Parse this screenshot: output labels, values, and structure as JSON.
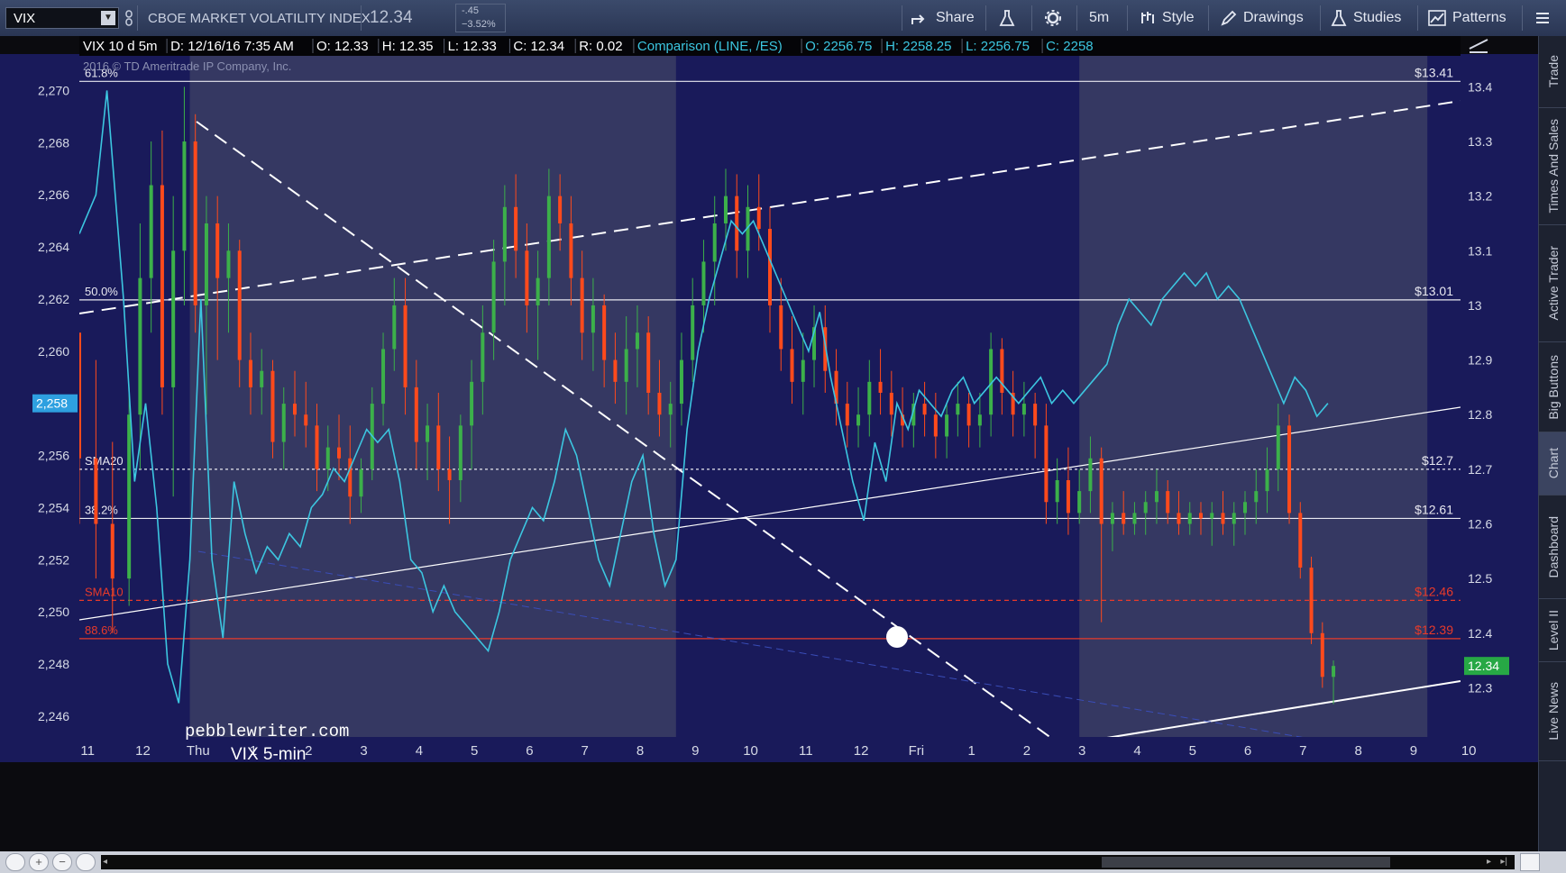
{
  "toolbar": {
    "symbol": "VIX",
    "title": "CBOE MARKET VOLATILITY INDEX",
    "last": "12.34",
    "change": "-.45",
    "change_pct": "−3.52%",
    "buttons": [
      {
        "label": "Share",
        "icon": "share-icon"
      },
      {
        "label": "",
        "icon": "flask-icon"
      },
      {
        "label": "",
        "icon": "gear-icon"
      },
      {
        "label": "5m",
        "icon": ""
      },
      {
        "label": "Style",
        "icon": "style-icon"
      },
      {
        "label": "Drawings",
        "icon": "pencil-icon"
      },
      {
        "label": "Studies",
        "icon": "flask-icon"
      },
      {
        "label": "Patterns",
        "icon": "patterns-icon"
      },
      {
        "label": "",
        "icon": "menu-icon"
      }
    ]
  },
  "header": {
    "study": "VIX 10 d 5m",
    "date": "D: 12/16/16 7:35 AM",
    "open": "O: 12.33",
    "high": "H: 12.35",
    "low": "L: 12.33",
    "close": "C: 12.34",
    "range": "R: 0.02",
    "comparison": "Comparison (LINE, /ES)",
    "cmp_open": "O: 2256.75",
    "cmp_high": "H: 2258.25",
    "cmp_low": "L: 2256.75",
    "cmp_close": "C: 2258"
  },
  "copyright": "2016 © TD Ameritrade IP Company, Inc.",
  "watermark": {
    "line1": "pebblewriter.com",
    "line2": "VIX 5-min"
  },
  "right_tabs": [
    "Trade",
    "Times And Sales",
    "Active Trader",
    "Big Buttons",
    "Chart",
    "Dashboard",
    "Level II",
    "Live News"
  ],
  "colors": {
    "background": "#191a5a",
    "shade": "#353862",
    "candle_up": "#3cb04a",
    "candle_down": "#ff4a1c",
    "compare_line": "#3cc6e0",
    "level_red": "#e83a2a"
  },
  "chart_data": {
    "type": "candlestick_with_comparison_line",
    "left_axis": {
      "label": "/ES",
      "ticks": [
        "2,270",
        "2,268",
        "2,266",
        "2,264",
        "2,262",
        "2,260",
        "2,258",
        "2,256",
        "2,254",
        "2,252",
        "2,250",
        "2,248",
        "2,246"
      ],
      "range": [
        2245.2,
        2271.4
      ]
    },
    "right_axis": {
      "label": "VIX",
      "ticks": [
        "13.4",
        "13.3",
        "13.2",
        "13.1",
        "13",
        "12.9",
        "12.8",
        "12.7",
        "12.6",
        "12.5",
        "12.4",
        "12.3"
      ],
      "range": [
        12.21,
        13.46
      ]
    },
    "left_marker": "2,258",
    "right_marker": "12.34",
    "x_ticks": [
      "11",
      "12",
      "Thu",
      "1",
      "2",
      "3",
      "4",
      "5",
      "6",
      "7",
      "8",
      "9",
      "10",
      "11",
      "12",
      "Fri",
      "1",
      "2",
      "3",
      "4",
      "5",
      "6",
      "7",
      "8",
      "9",
      "10"
    ],
    "session_shading": [
      {
        "from": 2.0,
        "to": 10.8
      },
      {
        "from": 18.1,
        "to": 24.4
      }
    ],
    "levels": [
      {
        "price": 13.41,
        "label": "$13.41",
        "fib": "61.8%",
        "style": "solid",
        "color": "white"
      },
      {
        "price": 13.01,
        "label": "$13.01",
        "fib": "50.0%",
        "style": "solid",
        "color": "white"
      },
      {
        "price": 12.7,
        "label": "$12.7",
        "fib": "SMA20",
        "style": "dotted",
        "color": "white"
      },
      {
        "price": 12.61,
        "label": "$12.61",
        "fib": "38.2%",
        "style": "solid",
        "color": "white"
      },
      {
        "price": 12.46,
        "label": "$12.46",
        "fib": "SMA10",
        "style": "dashed",
        "color": "red"
      },
      {
        "price": 12.39,
        "label": "$12.39",
        "fib": "88.6%",
        "style": "solid",
        "color": "red"
      }
    ],
    "vix_candles": [
      [
        0.0,
        12.95,
        12.95,
        12.6,
        12.72
      ],
      [
        0.3,
        12.72,
        12.9,
        12.5,
        12.6
      ],
      [
        0.6,
        12.6,
        12.75,
        12.4,
        12.5
      ],
      [
        0.9,
        12.5,
        12.85,
        12.45,
        12.8
      ],
      [
        1.1,
        12.8,
        13.15,
        12.7,
        13.05
      ],
      [
        1.3,
        13.05,
        13.3,
        12.95,
        13.22
      ],
      [
        1.5,
        13.22,
        13.32,
        12.8,
        12.85
      ],
      [
        1.7,
        12.85,
        13.2,
        12.65,
        13.1
      ],
      [
        1.9,
        13.1,
        13.4,
        13.0,
        13.3
      ],
      [
        2.1,
        13.3,
        13.35,
        12.95,
        13.0
      ],
      [
        2.3,
        13.0,
        13.2,
        12.8,
        13.15
      ],
      [
        2.5,
        13.15,
        13.2,
        12.9,
        13.05
      ],
      [
        2.7,
        13.05,
        13.15,
        12.95,
        13.1
      ],
      [
        2.9,
        13.1,
        13.12,
        12.85,
        12.9
      ],
      [
        3.1,
        12.9,
        12.95,
        12.8,
        12.85
      ],
      [
        3.3,
        12.85,
        12.92,
        12.8,
        12.88
      ],
      [
        3.5,
        12.88,
        12.9,
        12.72,
        12.75
      ],
      [
        3.7,
        12.75,
        12.85,
        12.7,
        12.82
      ],
      [
        3.9,
        12.82,
        12.88,
        12.76,
        12.8
      ],
      [
        4.1,
        12.8,
        12.86,
        12.74,
        12.78
      ],
      [
        4.3,
        12.78,
        12.82,
        12.66,
        12.7
      ],
      [
        4.5,
        12.7,
        12.78,
        12.66,
        12.74
      ],
      [
        4.7,
        12.74,
        12.8,
        12.68,
        12.72
      ],
      [
        4.9,
        12.72,
        12.78,
        12.6,
        12.65
      ],
      [
        5.1,
        12.65,
        12.72,
        12.62,
        12.7
      ],
      [
        5.3,
        12.7,
        12.85,
        12.68,
        12.82
      ],
      [
        5.5,
        12.82,
        12.95,
        12.78,
        12.92
      ],
      [
        5.7,
        12.92,
        13.05,
        12.88,
        13.0
      ],
      [
        5.9,
        13.0,
        13.05,
        12.8,
        12.85
      ],
      [
        6.1,
        12.85,
        12.9,
        12.7,
        12.75
      ],
      [
        6.3,
        12.75,
        12.82,
        12.68,
        12.78
      ],
      [
        6.5,
        12.78,
        12.84,
        12.66,
        12.7
      ],
      [
        6.7,
        12.7,
        12.76,
        12.6,
        12.68
      ],
      [
        6.9,
        12.68,
        12.8,
        12.64,
        12.78
      ],
      [
        7.1,
        12.78,
        12.9,
        12.7,
        12.86
      ],
      [
        7.3,
        12.86,
        13.0,
        12.8,
        12.95
      ],
      [
        7.5,
        12.95,
        13.12,
        12.9,
        13.08
      ],
      [
        7.7,
        13.08,
        13.22,
        13.0,
        13.18
      ],
      [
        7.9,
        13.18,
        13.24,
        13.05,
        13.1
      ],
      [
        8.1,
        13.1,
        13.15,
        12.95,
        13.0
      ],
      [
        8.3,
        13.0,
        13.1,
        12.9,
        13.05
      ],
      [
        8.5,
        13.05,
        13.25,
        13.0,
        13.2
      ],
      [
        8.7,
        13.2,
        13.24,
        13.1,
        13.15
      ],
      [
        8.9,
        13.15,
        13.2,
        13.0,
        13.05
      ],
      [
        9.1,
        13.05,
        13.1,
        12.9,
        12.95
      ],
      [
        9.3,
        12.95,
        13.05,
        12.88,
        13.0
      ],
      [
        9.5,
        13.0,
        13.02,
        12.85,
        12.9
      ],
      [
        9.7,
        12.9,
        12.95,
        12.82,
        12.86
      ],
      [
        9.9,
        12.86,
        12.98,
        12.8,
        12.92
      ],
      [
        10.1,
        12.92,
        13.0,
        12.85,
        12.95
      ],
      [
        10.3,
        12.95,
        12.98,
        12.8,
        12.84
      ],
      [
        10.5,
        12.84,
        12.9,
        12.76,
        12.8
      ],
      [
        10.7,
        12.8,
        12.86,
        12.74,
        12.82
      ],
      [
        10.9,
        12.82,
        12.95,
        12.78,
        12.9
      ],
      [
        11.1,
        12.9,
        13.05,
        12.86,
        13.0
      ],
      [
        11.3,
        13.0,
        13.12,
        12.95,
        13.08
      ],
      [
        11.5,
        13.08,
        13.2,
        13.0,
        13.15
      ],
      [
        11.7,
        13.15,
        13.25,
        13.1,
        13.2
      ],
      [
        11.9,
        13.2,
        13.24,
        13.05,
        13.1
      ],
      [
        12.1,
        13.1,
        13.22,
        13.05,
        13.18
      ],
      [
        12.3,
        13.18,
        13.24,
        13.1,
        13.14
      ],
      [
        12.5,
        13.14,
        13.18,
        12.95,
        13.0
      ],
      [
        12.7,
        13.0,
        13.05,
        12.88,
        12.92
      ],
      [
        12.9,
        12.92,
        12.98,
        12.82,
        12.86
      ],
      [
        13.1,
        12.86,
        12.95,
        12.8,
        12.9
      ],
      [
        13.3,
        12.9,
        13.0,
        12.85,
        12.96
      ],
      [
        13.5,
        12.96,
        13.0,
        12.84,
        12.88
      ],
      [
        13.7,
        12.88,
        12.92,
        12.78,
        12.82
      ],
      [
        13.9,
        12.82,
        12.86,
        12.74,
        12.78
      ],
      [
        14.1,
        12.78,
        12.85,
        12.74,
        12.8
      ],
      [
        14.3,
        12.8,
        12.9,
        12.76,
        12.86
      ],
      [
        14.5,
        12.86,
        12.92,
        12.8,
        12.84
      ],
      [
        14.7,
        12.84,
        12.88,
        12.76,
        12.8
      ],
      [
        14.9,
        12.8,
        12.85,
        12.74,
        12.78
      ],
      [
        15.1,
        12.78,
        12.84,
        12.74,
        12.82
      ],
      [
        15.3,
        12.82,
        12.86,
        12.76,
        12.8
      ],
      [
        15.5,
        12.8,
        12.84,
        12.72,
        12.76
      ],
      [
        15.7,
        12.76,
        12.82,
        12.72,
        12.8
      ],
      [
        15.9,
        12.8,
        12.86,
        12.76,
        12.82
      ],
      [
        16.1,
        12.82,
        12.84,
        12.74,
        12.78
      ],
      [
        16.3,
        12.78,
        12.84,
        12.74,
        12.8
      ],
      [
        16.5,
        12.8,
        12.95,
        12.76,
        12.92
      ],
      [
        16.7,
        12.92,
        12.94,
        12.8,
        12.84
      ],
      [
        16.9,
        12.84,
        12.88,
        12.76,
        12.8
      ],
      [
        17.1,
        12.8,
        12.86,
        12.76,
        12.82
      ],
      [
        17.3,
        12.82,
        12.84,
        12.72,
        12.78
      ],
      [
        17.5,
        12.78,
        12.82,
        12.6,
        12.64
      ],
      [
        17.7,
        12.64,
        12.72,
        12.6,
        12.68
      ],
      [
        17.9,
        12.68,
        12.74,
        12.58,
        12.62
      ],
      [
        18.1,
        12.62,
        12.7,
        12.6,
        12.66
      ],
      [
        18.3,
        12.66,
        12.76,
        12.62,
        12.72
      ],
      [
        18.5,
        12.72,
        12.74,
        12.42,
        12.6
      ],
      [
        18.7,
        12.6,
        12.64,
        12.55,
        12.62
      ],
      [
        18.9,
        12.62,
        12.66,
        12.58,
        12.6
      ],
      [
        19.1,
        12.6,
        12.64,
        12.58,
        12.62
      ],
      [
        19.3,
        12.62,
        12.66,
        12.58,
        12.64
      ],
      [
        19.5,
        12.64,
        12.7,
        12.6,
        12.66
      ],
      [
        19.7,
        12.66,
        12.68,
        12.6,
        12.62
      ],
      [
        19.9,
        12.62,
        12.66,
        12.58,
        12.6
      ],
      [
        20.1,
        12.6,
        12.64,
        12.58,
        12.62
      ],
      [
        20.3,
        12.62,
        12.64,
        12.58,
        12.61
      ],
      [
        20.5,
        12.61,
        12.64,
        12.56,
        12.62
      ],
      [
        20.7,
        12.62,
        12.66,
        12.58,
        12.6
      ],
      [
        20.9,
        12.6,
        12.64,
        12.56,
        12.62
      ],
      [
        21.1,
        12.62,
        12.66,
        12.58,
        12.64
      ],
      [
        21.3,
        12.64,
        12.7,
        12.6,
        12.66
      ],
      [
        21.5,
        12.66,
        12.74,
        12.62,
        12.7
      ],
      [
        21.7,
        12.7,
        12.82,
        12.66,
        12.78
      ],
      [
        21.9,
        12.78,
        12.8,
        12.6,
        12.62
      ],
      [
        22.1,
        12.62,
        12.64,
        12.5,
        12.52
      ],
      [
        22.3,
        12.52,
        12.54,
        12.38,
        12.4
      ],
      [
        22.5,
        12.4,
        12.42,
        12.3,
        12.32
      ],
      [
        22.7,
        12.32,
        12.35,
        12.27,
        12.34
      ]
    ],
    "es_line": [
      [
        0.0,
        2264.5
      ],
      [
        0.3,
        2266.0
      ],
      [
        0.5,
        2270.0
      ],
      [
        0.8,
        2262.0
      ],
      [
        1.0,
        2255.0
      ],
      [
        1.2,
        2258.0
      ],
      [
        1.4,
        2254.0
      ],
      [
        1.6,
        2248.0
      ],
      [
        1.8,
        2246.5
      ],
      [
        2.0,
        2252.0
      ],
      [
        2.2,
        2262.0
      ],
      [
        2.4,
        2252.0
      ],
      [
        2.6,
        2249.0
      ],
      [
        2.8,
        2255.0
      ],
      [
        3.0,
        2253.0
      ],
      [
        3.2,
        2251.5
      ],
      [
        3.4,
        2252.5
      ],
      [
        3.6,
        2252.0
      ],
      [
        3.8,
        2253.0
      ],
      [
        4.0,
        2252.5
      ],
      [
        4.2,
        2254.0
      ],
      [
        4.4,
        2254.5
      ],
      [
        4.6,
        2255.5
      ],
      [
        4.8,
        2255.0
      ],
      [
        5.0,
        2256.0
      ],
      [
        5.2,
        2257.0
      ],
      [
        5.4,
        2256.5
      ],
      [
        5.6,
        2257.0
      ],
      [
        5.8,
        2255.0
      ],
      [
        6.0,
        2252.0
      ],
      [
        6.2,
        2251.5
      ],
      [
        6.4,
        2250.0
      ],
      [
        6.6,
        2251.0
      ],
      [
        6.8,
        2250.0
      ],
      [
        7.0,
        2249.5
      ],
      [
        7.2,
        2249.0
      ],
      [
        7.4,
        2248.5
      ],
      [
        7.6,
        2250.0
      ],
      [
        7.8,
        2252.0
      ],
      [
        8.0,
        2253.0
      ],
      [
        8.2,
        2254.0
      ],
      [
        8.4,
        2253.5
      ],
      [
        8.6,
        2255.0
      ],
      [
        8.8,
        2257.0
      ],
      [
        9.0,
        2256.0
      ],
      [
        9.2,
        2254.0
      ],
      [
        9.4,
        2252.0
      ],
      [
        9.6,
        2251.0
      ],
      [
        9.8,
        2253.0
      ],
      [
        10.0,
        2255.0
      ],
      [
        10.2,
        2256.0
      ],
      [
        10.4,
        2253.0
      ],
      [
        10.6,
        2251.0
      ],
      [
        10.8,
        2252.0
      ],
      [
        11.0,
        2257.0
      ],
      [
        11.2,
        2260.0
      ],
      [
        11.4,
        2262.0
      ],
      [
        11.6,
        2263.5
      ],
      [
        11.8,
        2265.0
      ],
      [
        12.0,
        2264.5
      ],
      [
        12.2,
        2265.0
      ],
      [
        12.4,
        2264.0
      ],
      [
        12.6,
        2263.0
      ],
      [
        12.8,
        2262.0
      ],
      [
        13.0,
        2261.0
      ],
      [
        13.2,
        2260.0
      ],
      [
        13.4,
        2261.5
      ],
      [
        13.6,
        2259.0
      ],
      [
        13.8,
        2257.0
      ],
      [
        14.0,
        2255.0
      ],
      [
        14.2,
        2253.5
      ],
      [
        14.4,
        2256.5
      ],
      [
        14.6,
        2255.0
      ],
      [
        14.8,
        2258.0
      ],
      [
        15.0,
        2257.0
      ],
      [
        15.2,
        2258.5
      ],
      [
        15.4,
        2258.0
      ],
      [
        15.6,
        2257.5
      ],
      [
        15.8,
        2258.5
      ],
      [
        16.0,
        2259.0
      ],
      [
        16.2,
        2258.0
      ],
      [
        16.4,
        2258.5
      ],
      [
        16.6,
        2259.0
      ],
      [
        16.8,
        2258.5
      ],
      [
        17.0,
        2258.0
      ],
      [
        17.2,
        2258.5
      ],
      [
        17.4,
        2259.0
      ],
      [
        17.6,
        2258.0
      ],
      [
        17.8,
        2258.5
      ],
      [
        18.0,
        2258.0
      ],
      [
        18.2,
        2258.5
      ],
      [
        18.4,
        2259.0
      ],
      [
        18.6,
        2259.5
      ],
      [
        18.8,
        2261.0
      ],
      [
        19.0,
        2262.0
      ],
      [
        19.2,
        2261.5
      ],
      [
        19.4,
        2261.0
      ],
      [
        19.6,
        2262.0
      ],
      [
        19.8,
        2262.5
      ],
      [
        20.0,
        2263.0
      ],
      [
        20.2,
        2262.5
      ],
      [
        20.4,
        2263.0
      ],
      [
        20.6,
        2262.0
      ],
      [
        20.8,
        2262.5
      ],
      [
        21.0,
        2262.0
      ],
      [
        21.2,
        2261.0
      ],
      [
        21.4,
        2260.0
      ],
      [
        21.6,
        2259.0
      ],
      [
        21.8,
        2258.0
      ],
      [
        22.0,
        2259.0
      ],
      [
        22.2,
        2258.5
      ],
      [
        22.4,
        2257.5
      ],
      [
        22.6,
        2258.0
      ]
    ]
  }
}
